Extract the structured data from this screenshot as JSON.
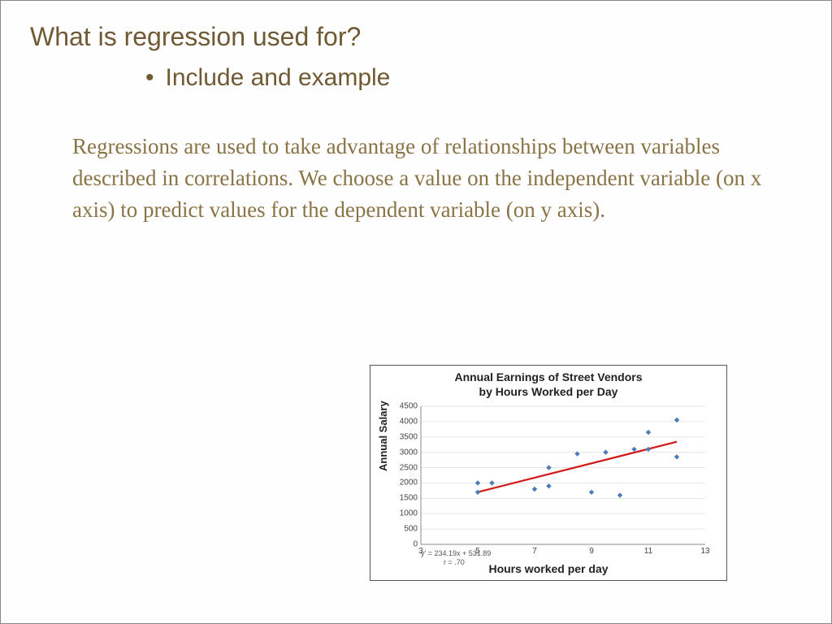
{
  "title": "What is regression used for?",
  "bullet": "Include and example",
  "body": "Regressions are used to take advantage of relationships between variables described in correlations.  We choose a value on the independent variable (on x axis) to predict values for the dependent variable (on y axis).",
  "chart_data": {
    "type": "scatter",
    "title": "Annual Earnings of Street Vendors\nby Hours Worked per Day",
    "xlabel": "Hours worked per day",
    "ylabel": "Annual Salary",
    "xlim": [
      3,
      13
    ],
    "ylim": [
      0,
      4500
    ],
    "xticks": [
      3,
      5,
      7,
      9,
      11,
      13
    ],
    "yticks": [
      0,
      500,
      1000,
      1500,
      2000,
      2500,
      3000,
      3500,
      4000,
      4500
    ],
    "equation": "y' = 234.19x + 531.89",
    "r": "r = .70",
    "points": [
      {
        "x": 5.0,
        "y": 1700
      },
      {
        "x": 5.0,
        "y": 2000
      },
      {
        "x": 5.5,
        "y": 2000
      },
      {
        "x": 7.0,
        "y": 1800
      },
      {
        "x": 7.5,
        "y": 1900
      },
      {
        "x": 7.5,
        "y": 2500
      },
      {
        "x": 8.5,
        "y": 2950
      },
      {
        "x": 9.0,
        "y": 1700
      },
      {
        "x": 9.5,
        "y": 3000
      },
      {
        "x": 10.0,
        "y": 1600
      },
      {
        "x": 10.5,
        "y": 3100
      },
      {
        "x": 11.0,
        "y": 3100
      },
      {
        "x": 11.0,
        "y": 3650
      },
      {
        "x": 12.0,
        "y": 2850
      },
      {
        "x": 12.0,
        "y": 4050
      }
    ],
    "regression": {
      "slope": 234.19,
      "intercept": 531.89,
      "x1": 5,
      "x2": 12
    }
  }
}
